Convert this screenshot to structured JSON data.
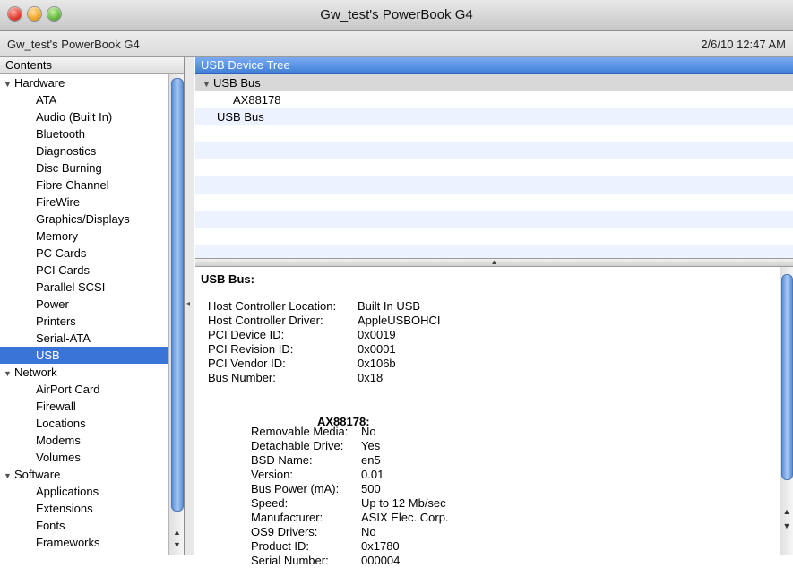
{
  "window": {
    "title": "Gw_test's PowerBook G4"
  },
  "subbar": {
    "machine": "Gw_test's PowerBook G4",
    "datetime": "2/6/10 12:47 AM"
  },
  "sidebar": {
    "header": "Contents",
    "rows": [
      {
        "label": "Hardware",
        "type": "cat"
      },
      {
        "label": "ATA",
        "type": "item"
      },
      {
        "label": "Audio (Built In)",
        "type": "item"
      },
      {
        "label": "Bluetooth",
        "type": "item"
      },
      {
        "label": "Diagnostics",
        "type": "item"
      },
      {
        "label": "Disc Burning",
        "type": "item"
      },
      {
        "label": "Fibre Channel",
        "type": "item"
      },
      {
        "label": "FireWire",
        "type": "item"
      },
      {
        "label": "Graphics/Displays",
        "type": "item"
      },
      {
        "label": "Memory",
        "type": "item"
      },
      {
        "label": "PC Cards",
        "type": "item"
      },
      {
        "label": "PCI Cards",
        "type": "item"
      },
      {
        "label": "Parallel SCSI",
        "type": "item"
      },
      {
        "label": "Power",
        "type": "item"
      },
      {
        "label": "Printers",
        "type": "item"
      },
      {
        "label": "Serial-ATA",
        "type": "item"
      },
      {
        "label": "USB",
        "type": "item",
        "selected": true
      },
      {
        "label": "Network",
        "type": "cat"
      },
      {
        "label": "AirPort Card",
        "type": "item"
      },
      {
        "label": "Firewall",
        "type": "item"
      },
      {
        "label": "Locations",
        "type": "item"
      },
      {
        "label": "Modems",
        "type": "item"
      },
      {
        "label": "Volumes",
        "type": "item"
      },
      {
        "label": "Software",
        "type": "cat"
      },
      {
        "label": "Applications",
        "type": "item"
      },
      {
        "label": "Extensions",
        "type": "item"
      },
      {
        "label": "Fonts",
        "type": "item"
      },
      {
        "label": "Frameworks",
        "type": "item"
      }
    ]
  },
  "tree": {
    "header": "USB Device Tree",
    "bus1": "USB Bus",
    "device": "AX88178",
    "bus2": "USB Bus"
  },
  "detail": {
    "title": "USB Bus:",
    "bus_fields": [
      {
        "k": "Host Controller Location:",
        "v": "Built In USB"
      },
      {
        "k": "Host Controller Driver:",
        "v": "AppleUSBOHCI"
      },
      {
        "k": "PCI Device ID:",
        "v": "0x0019"
      },
      {
        "k": "PCI Revision ID:",
        "v": "0x0001"
      },
      {
        "k": "PCI Vendor ID:",
        "v": "0x106b"
      },
      {
        "k": "Bus Number:",
        "v": "0x18"
      }
    ],
    "device_title": "AX88178:",
    "device_fields": [
      {
        "k": "Removable Media:",
        "v": "No"
      },
      {
        "k": "Detachable Drive:",
        "v": "Yes"
      },
      {
        "k": "BSD Name:",
        "v": "en5"
      },
      {
        "k": "Version:",
        "v": "0.01"
      },
      {
        "k": "Bus Power (mA):",
        "v": "500"
      },
      {
        "k": "Speed:",
        "v": "Up to 12 Mb/sec"
      },
      {
        "k": "Manufacturer:",
        "v": "ASIX Elec. Corp."
      },
      {
        "k": "OS9 Drivers:",
        "v": "No"
      },
      {
        "k": "Product ID:",
        "v": "0x1780"
      },
      {
        "k": "Serial Number:",
        "v": "000004"
      }
    ]
  }
}
